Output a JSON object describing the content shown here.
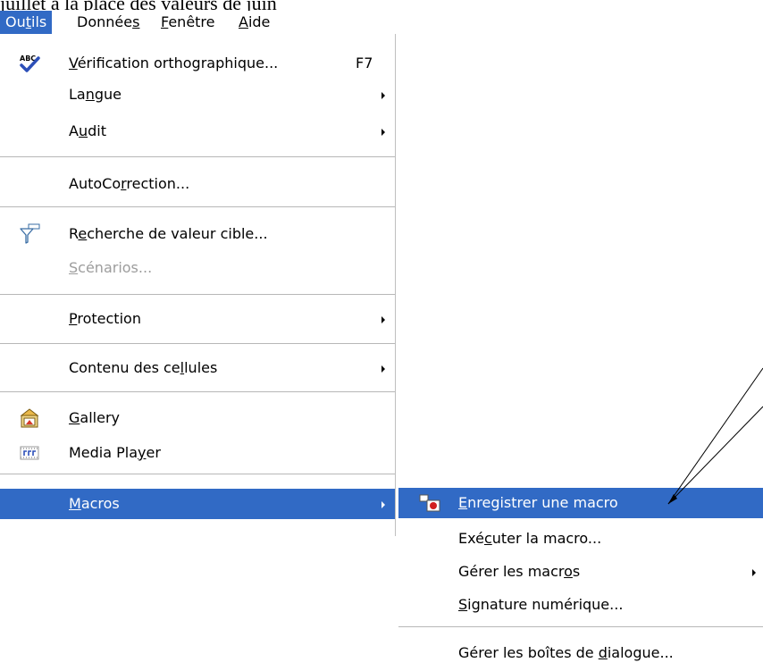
{
  "background_text": "juillet à la place des valeurs de juin",
  "menubar": {
    "items": [
      {
        "pre": "Ou",
        "u": "t",
        "post": "ils"
      },
      {
        "pre": "Donnée",
        "u": "s",
        "post": ""
      },
      {
        "pre": "",
        "u": "F",
        "post": "enêtre"
      },
      {
        "pre": "",
        "u": "A",
        "post": "ide"
      }
    ]
  },
  "menu": {
    "spelling": {
      "pre": "",
      "u": "V",
      "post": "érification orthographique...",
      "shortcut": "F7",
      "icon": "spellcheck-icon"
    },
    "language": {
      "pre": "La",
      "u": "n",
      "post": "gue"
    },
    "audit": {
      "pre": "A",
      "u": "u",
      "post": "dit"
    },
    "autocorrect": {
      "pre": "AutoCo",
      "u": "r",
      "post": "rection..."
    },
    "goal_seek": {
      "pre": "R",
      "u": "e",
      "post": "cherche de valeur cible...",
      "icon": "funnel-icon"
    },
    "scenarios": {
      "pre": "",
      "u": "S",
      "post": "cénarios..."
    },
    "protection": {
      "pre": "",
      "u": "P",
      "post": "rotection"
    },
    "cell_contents": {
      "pre": "Contenu des ce",
      "u": "l",
      "post": "lules"
    },
    "gallery": {
      "pre": "",
      "u": "G",
      "post": "allery",
      "icon": "gallery-icon"
    },
    "media_player": {
      "pre": "Media Pla",
      "u": "y",
      "post": "er",
      "icon": "media-player-icon"
    },
    "macros": {
      "pre": "",
      "u": "M",
      "post": "acros"
    }
  },
  "submenu": {
    "record": {
      "pre": "",
      "u": "E",
      "post": "nregistrer une macro",
      "icon": "record-macro-icon"
    },
    "run": {
      "pre": "Exé",
      "u": "c",
      "post": "uter la macro..."
    },
    "organize": {
      "pre": "Gérer les macr",
      "u": "o",
      "post": "s"
    },
    "signature": {
      "pre": "",
      "u": "S",
      "post": "ignature numérique..."
    },
    "dialogs": {
      "pre": "Gérer les boîtes de ",
      "u": "d",
      "post": "ialogue..."
    }
  },
  "colors": {
    "highlight": "#316ac5",
    "disabled": "#9d9d9d"
  }
}
